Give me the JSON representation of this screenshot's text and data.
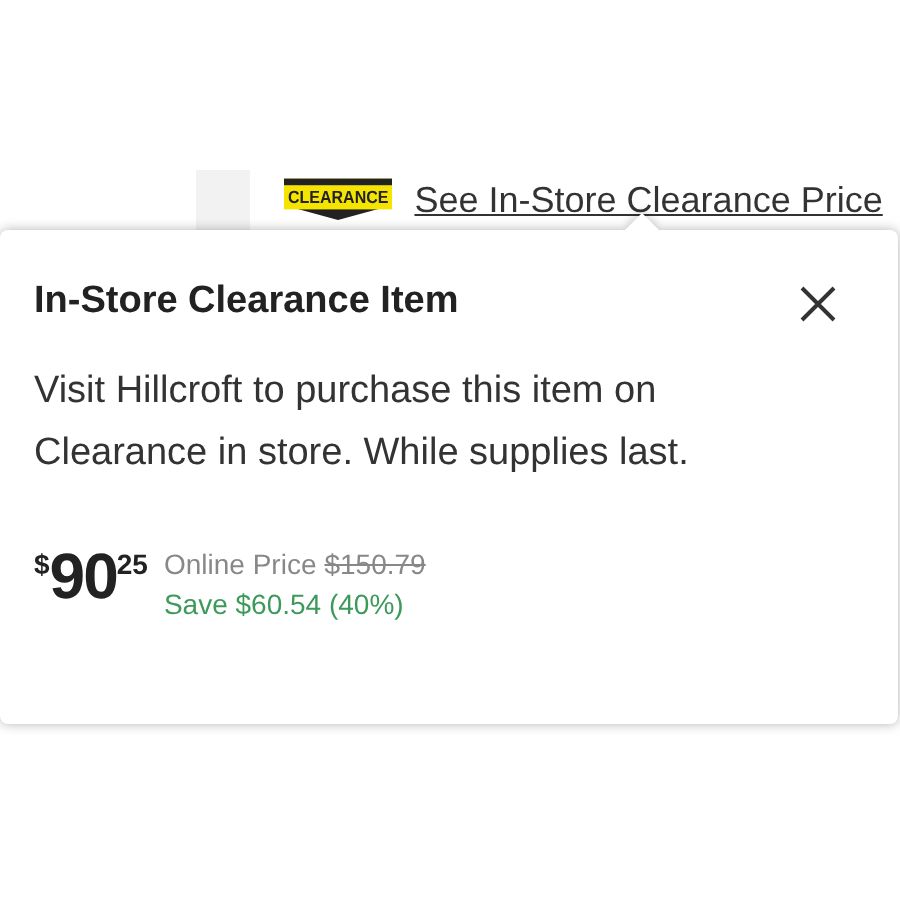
{
  "clearance_badge": {
    "label": "CLEARANCE"
  },
  "link": {
    "label": "See In-Store Clearance Price"
  },
  "popover": {
    "title": "In-Store Clearance Item",
    "message": "Visit Hillcroft to purchase this item on Clearance in store. While supplies last.",
    "price": {
      "currency": "$",
      "dollars": "90",
      "cents": "25",
      "online_label": "Online Price",
      "online_price": "$150.79",
      "savings": "Save $60.54 (40%)"
    }
  }
}
